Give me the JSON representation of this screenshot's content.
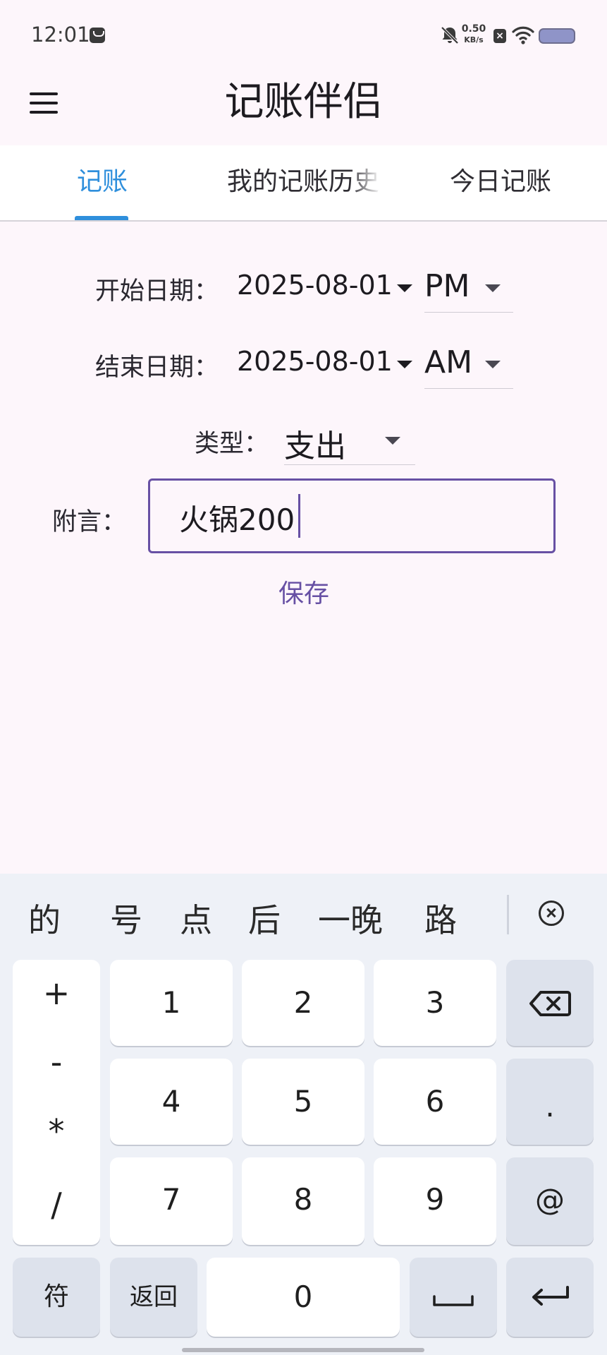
{
  "status": {
    "time": "12:01",
    "net_speed_value": "0.50",
    "net_speed_unit": "KB/s",
    "sim_badge": "×",
    "icons": [
      "message-icon",
      "mute-icon",
      "sim-icon",
      "wifi-icon",
      "battery-icon"
    ]
  },
  "app_bar": {
    "title": "记账伴侣",
    "menu_icon": "hamburger-menu-icon"
  },
  "tabs": [
    {
      "label": "记账",
      "selected": true
    },
    {
      "label": "我的记账历史",
      "selected": false
    },
    {
      "label": "今日记账",
      "selected": false
    }
  ],
  "form": {
    "start_label": "开始日期：",
    "start_date": "2025-08-01",
    "start_period": "PM",
    "end_label": "结束日期：",
    "end_date": "2025-08-01",
    "end_period": "AM",
    "type_label": "类型：",
    "type_value": "支出",
    "note_label": "附言：",
    "note_value": "火锅200",
    "save_label": "保存"
  },
  "keyboard": {
    "candidates": [
      "的",
      "号",
      "点",
      "后",
      "一晚",
      "路"
    ],
    "operators": [
      "+",
      "-",
      "*",
      "/"
    ],
    "digits": [
      "1",
      "2",
      "3",
      "4",
      "5",
      "6",
      "7",
      "8",
      "9",
      "0"
    ],
    "dot": ".",
    "at": "@",
    "symbols_label": "符",
    "back_label": "返回",
    "icons": [
      "candidate-close-icon",
      "backspace-icon",
      "space-icon",
      "enter-icon"
    ]
  },
  "colors": {
    "accent_tab": "#2f8fdc",
    "primary": "#6750a4",
    "background": "#fdf6fb",
    "keyboard_bg": "#eef1f7"
  }
}
